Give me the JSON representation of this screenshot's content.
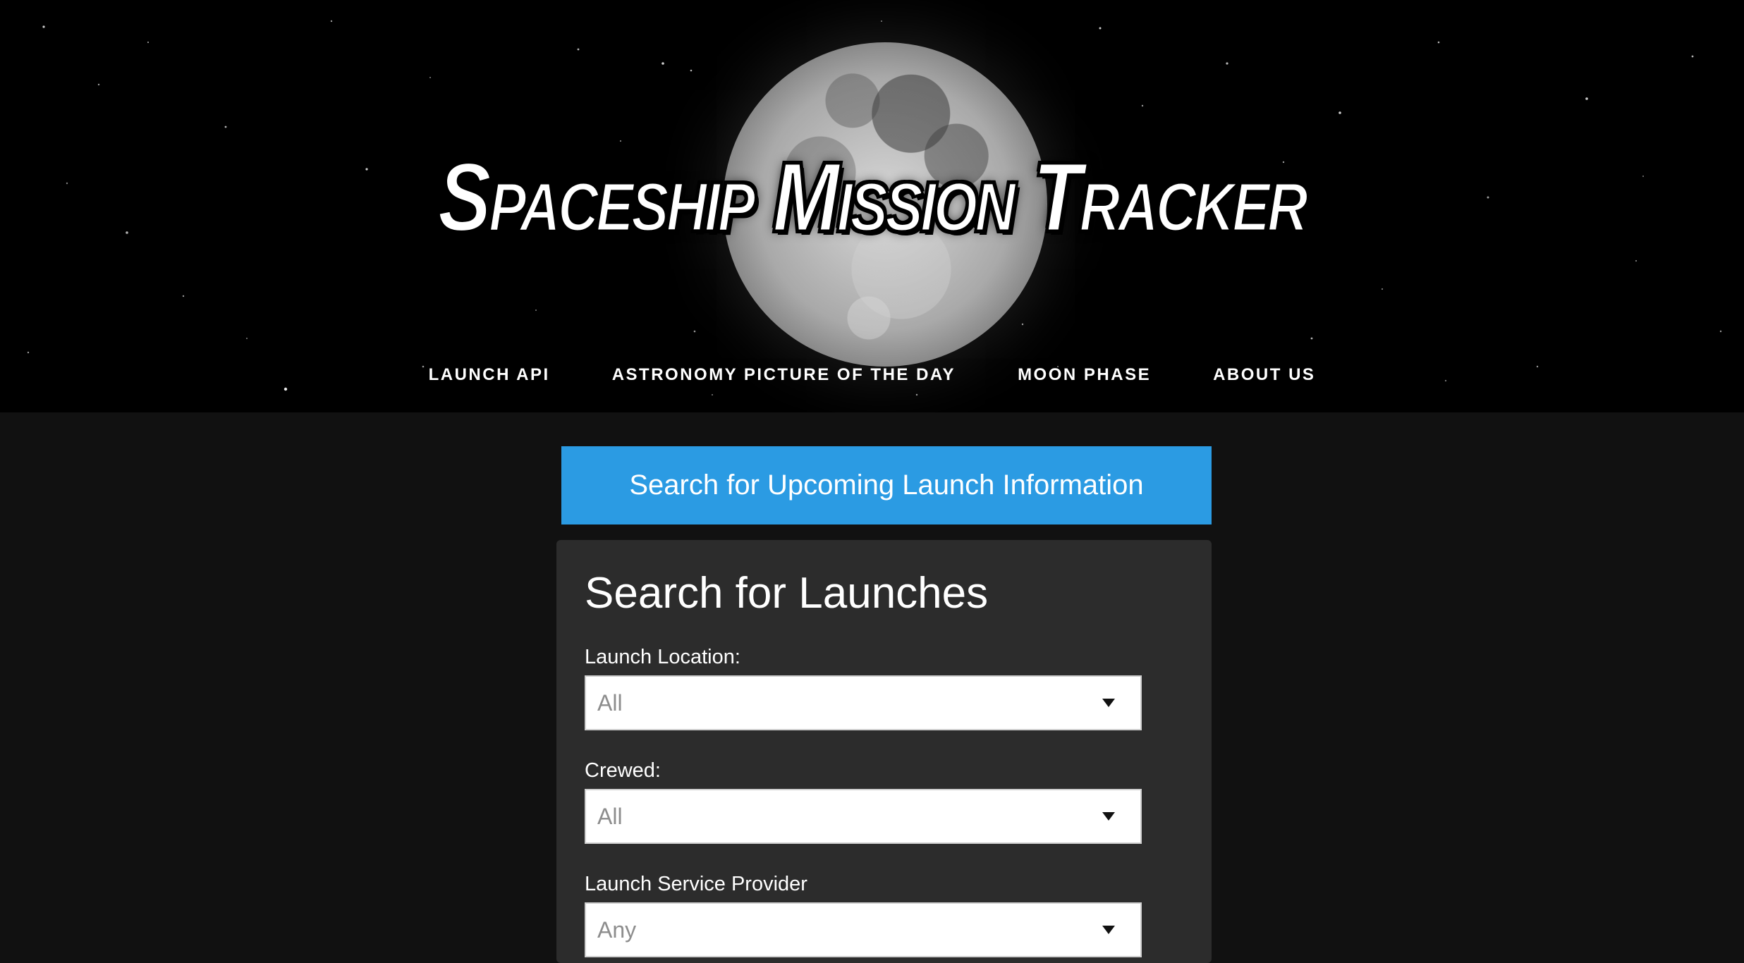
{
  "header": {
    "logo_text": "Spaceship Mission Tracker"
  },
  "nav": {
    "items": [
      {
        "label": "LAUNCH API"
      },
      {
        "label": "ASTRONOMY PICTURE OF THE DAY"
      },
      {
        "label": "MOON PHASE"
      },
      {
        "label": "ABOUT US"
      }
    ]
  },
  "banner": {
    "label": "Search for Upcoming Launch Information",
    "color": "#2b9be3"
  },
  "search_form": {
    "title": "Search for Launches",
    "fields": [
      {
        "label": "Launch Location:",
        "value": "All"
      },
      {
        "label": "Crewed:",
        "value": "All"
      },
      {
        "label": "Launch Service Provider",
        "value": "Any"
      }
    ]
  },
  "icons": {
    "dropdown": "chevron-down-icon",
    "moon": "moon-image"
  }
}
